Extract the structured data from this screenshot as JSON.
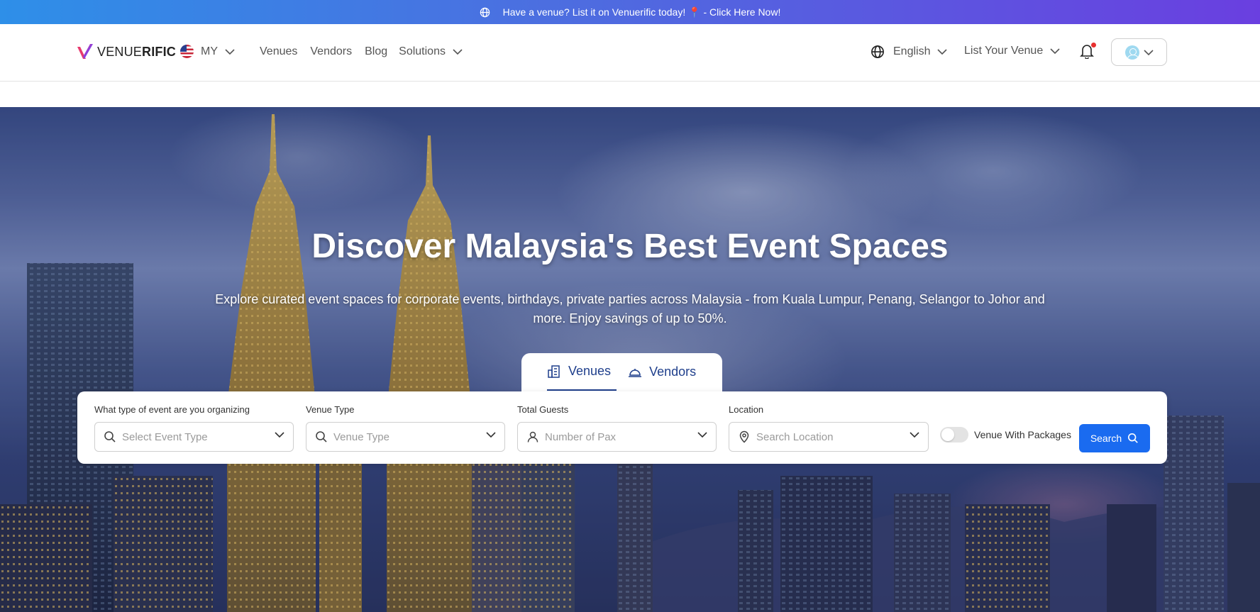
{
  "announcement": {
    "text": "Have a venue? List it on Venuerific today! 📍 - Click Here Now!"
  },
  "header": {
    "logo_light": "VENUE",
    "logo_bold": "RIFIC",
    "country_code": "MY",
    "nav": [
      "Venues",
      "Vendors",
      "Blog",
      "Solutions"
    ],
    "language": "English",
    "list_venue": "List Your Venue"
  },
  "hero": {
    "title": "Discover Malaysia's Best Event Spaces",
    "subtitle": "Explore curated event spaces for corporate events, birthdays, private parties across Malaysia - from Kuala Lumpur, Penang, Selangor to Johor and more. Enjoy savings of up to 50%."
  },
  "tabs": [
    {
      "label": "Venues",
      "active": true
    },
    {
      "label": "Vendors",
      "active": false
    }
  ],
  "search": {
    "event_type": {
      "label": "What type of event are you organizing",
      "placeholder": "Select Event Type"
    },
    "venue_type": {
      "label": "Venue Type",
      "placeholder": "Venue Type"
    },
    "guests": {
      "label": "Total Guests",
      "placeholder": "Number of Pax"
    },
    "location": {
      "label": "Location",
      "placeholder": "Search Location"
    },
    "packages_toggle": {
      "label": "Venue With Packages",
      "on": false
    },
    "button": "Search"
  },
  "colors": {
    "accent": "#1a6bf0",
    "tab_active": "#1f3f8c",
    "announce_start": "#2e8fe8",
    "announce_end": "#6a3fe0"
  }
}
